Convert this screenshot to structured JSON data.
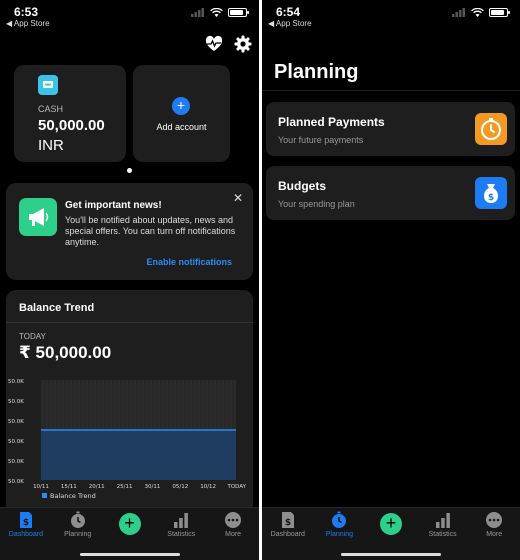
{
  "colors": {
    "accent_blue": "#1e7cf2",
    "green": "#2ecf8a",
    "cash_blue": "#3ac5e8",
    "orange": "#f29a22",
    "budget_blue": "#1e7cf2",
    "chart_fill": "#1e3f66",
    "chart_line": "#2b8cf7"
  },
  "left_screen": {
    "status": {
      "time": "6:53",
      "back": "◀ App Store"
    },
    "top_icons": [
      "heart-pulse-icon",
      "gear-icon"
    ],
    "cash_card": {
      "label": "CASH",
      "amount": "50,000.00",
      "currency": "INR"
    },
    "add_card": {
      "plus": "+",
      "label": "Add account"
    },
    "news": {
      "title": "Get important news!",
      "body": "You'll be notified about updates, news and special offers. You can turn off notifications anytime.",
      "close": "✕",
      "link": "Enable notifications"
    },
    "trend": {
      "title": "Balance Trend",
      "today_label": "TODAY",
      "value": "₹ 50,000.00"
    },
    "tabs": [
      {
        "label": "Dashboard",
        "icon": "dollar-doc-icon",
        "active": true
      },
      {
        "label": "Planning",
        "icon": "clock-icon",
        "active": false
      },
      {
        "label": "",
        "icon": "plus-icon",
        "active": false
      },
      {
        "label": "Statistics",
        "icon": "bars-icon",
        "active": false
      },
      {
        "label": "More",
        "icon": "more-icon",
        "active": false
      }
    ]
  },
  "right_screen": {
    "status": {
      "time": "6:54",
      "back": "◀ App Store"
    },
    "title": "Planning",
    "cards": [
      {
        "title": "Planned Payments",
        "subtitle": "Your future payments",
        "icon": "clock-icon"
      },
      {
        "title": "Budgets",
        "subtitle": "Your spending plan",
        "icon": "money-bag-icon"
      }
    ],
    "tabs": [
      {
        "label": "Dashboard",
        "icon": "dollar-doc-icon",
        "active": false
      },
      {
        "label": "Planning",
        "icon": "clock-icon",
        "active": true
      },
      {
        "label": "",
        "icon": "plus-icon",
        "active": false
      },
      {
        "label": "Statistics",
        "icon": "bars-icon",
        "active": false
      },
      {
        "label": "More",
        "icon": "more-icon",
        "active": false
      }
    ]
  },
  "chart_data": {
    "type": "area",
    "title": "Balance Trend",
    "x": [
      "10/11",
      "15/11",
      "20/11",
      "25/11",
      "30/11",
      "05/12",
      "10/12",
      "TODAY"
    ],
    "y_ticks": [
      "50.0K",
      "50.0K",
      "50.0K",
      "50.0K",
      "50.0K",
      "50.0K"
    ],
    "series": [
      {
        "name": "Balance Trend",
        "values": [
          50000,
          50000,
          50000,
          50000,
          50000,
          50000,
          50000,
          50000
        ]
      }
    ],
    "legend": "bottom-left"
  }
}
